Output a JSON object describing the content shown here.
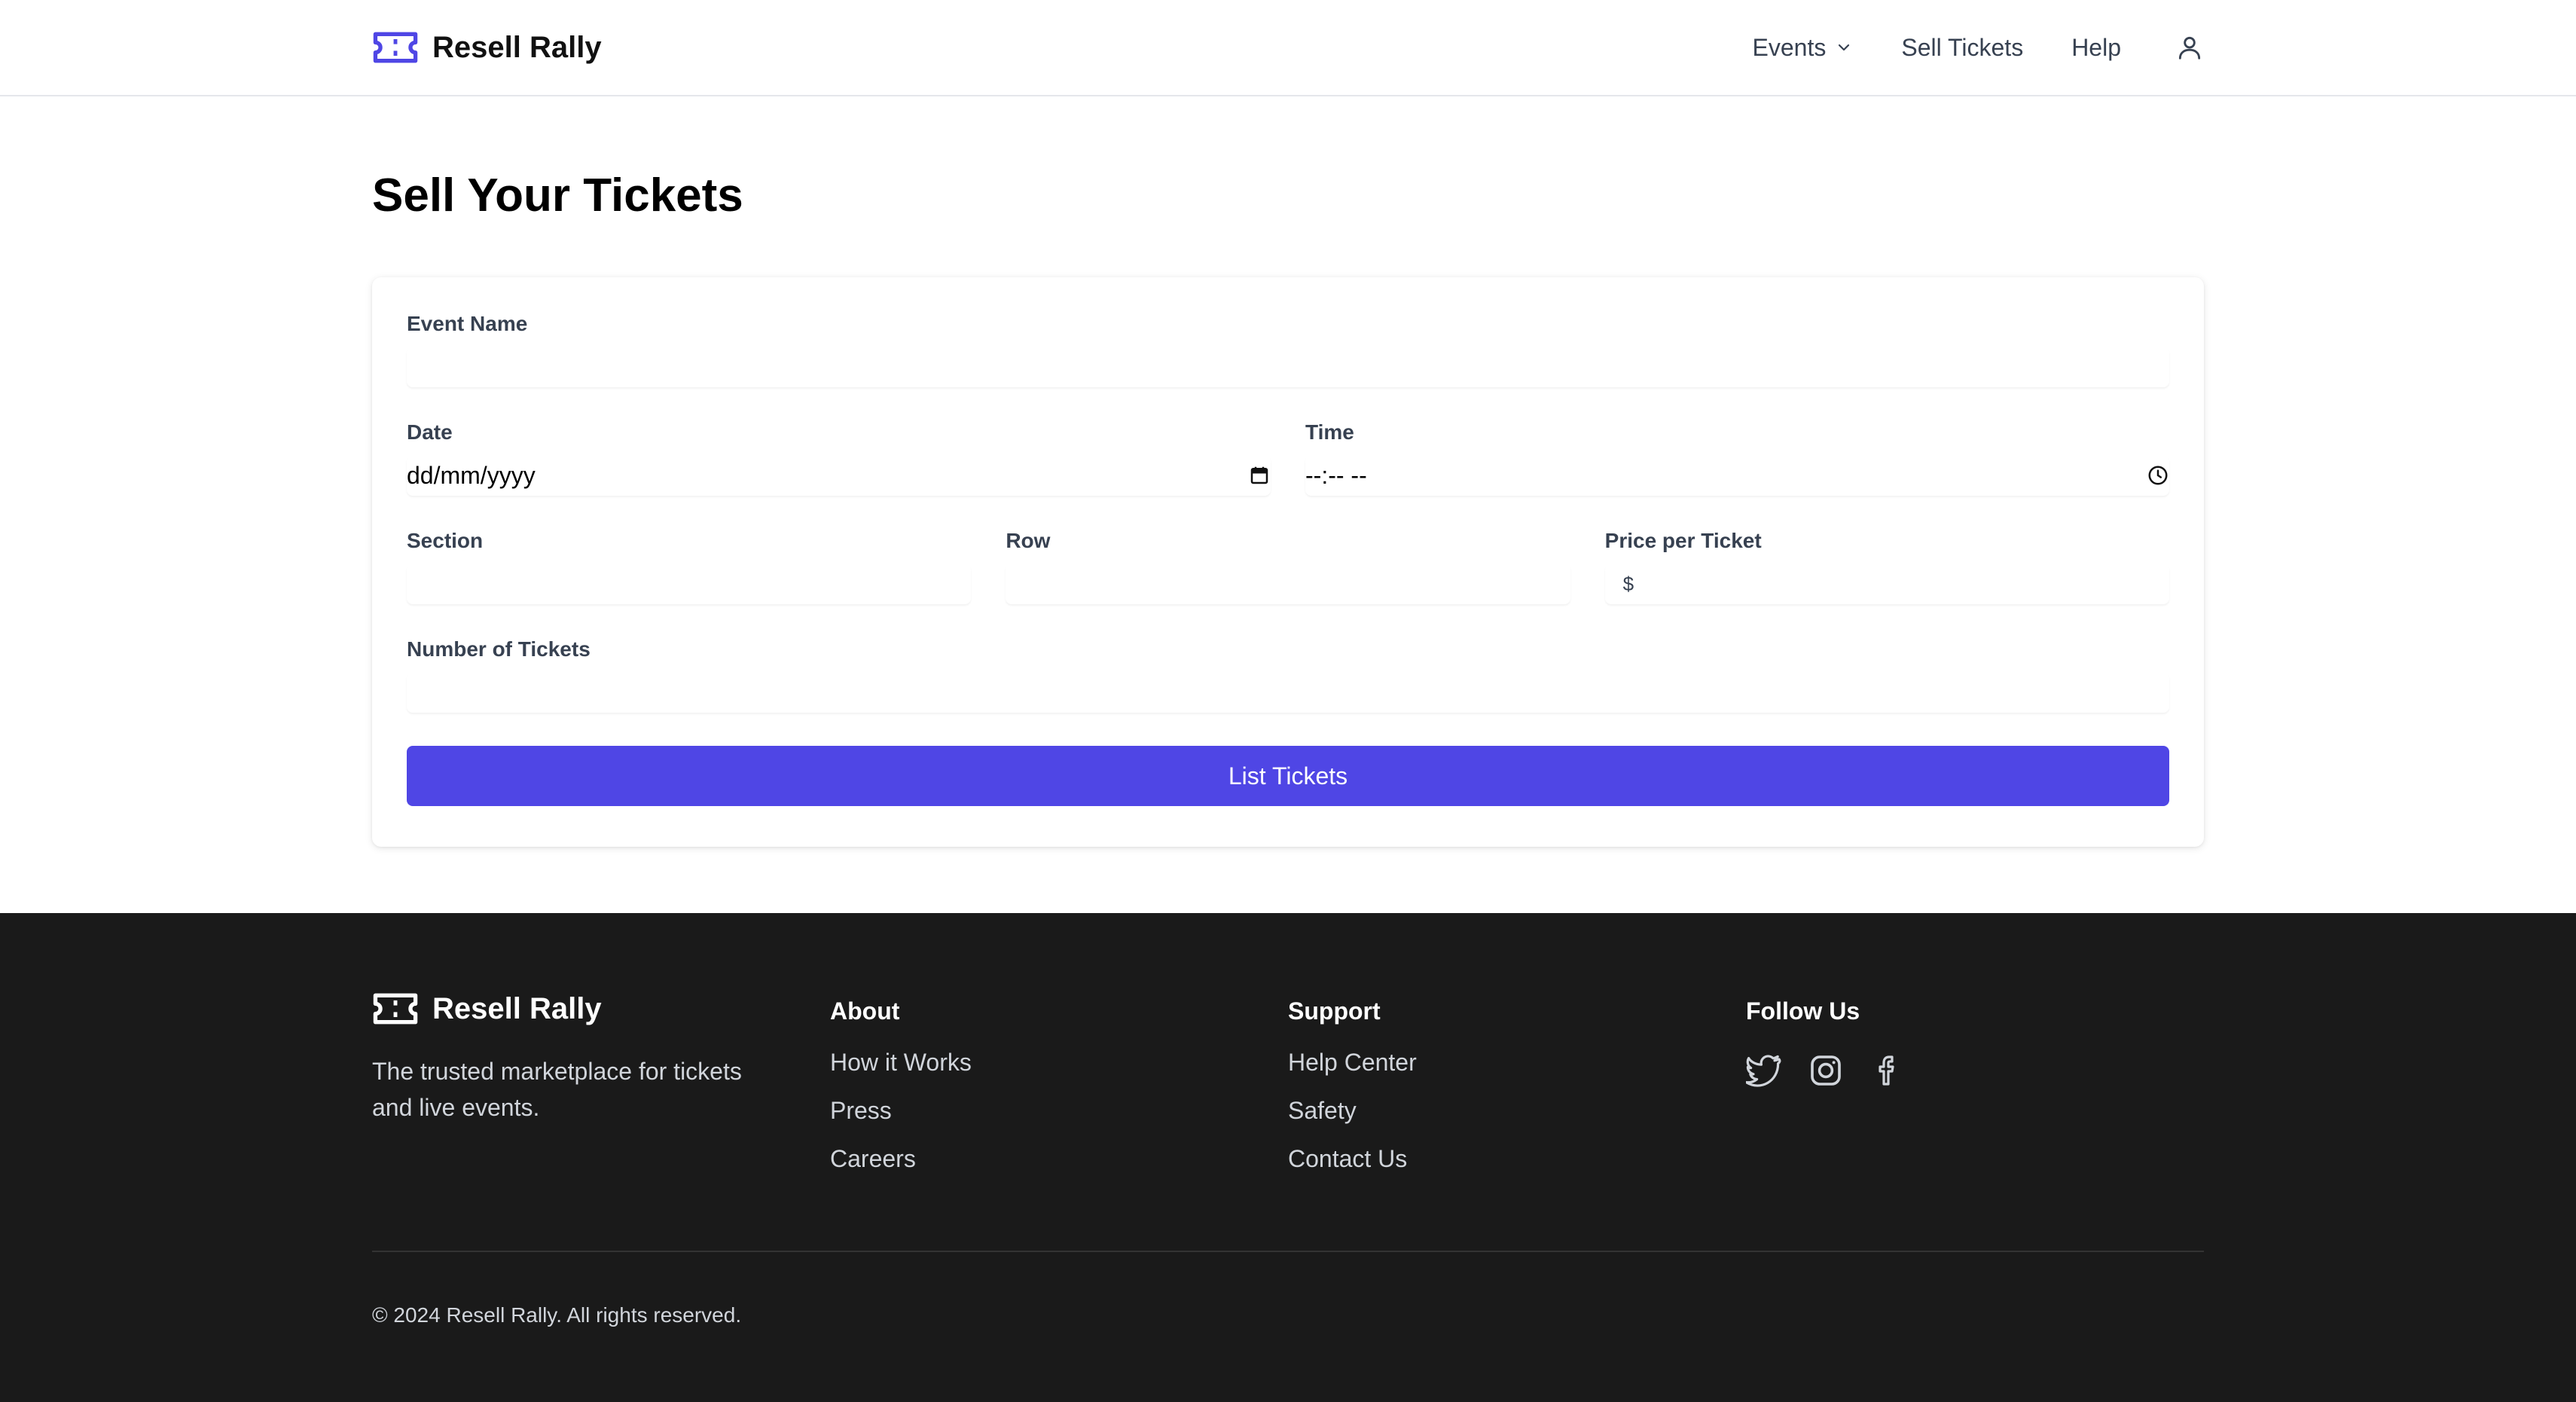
{
  "brand": {
    "name": "Resell Rally",
    "accent": "#4f46e5"
  },
  "nav": {
    "events_label": "Events",
    "sell_label": "Sell Tickets",
    "help_label": "Help",
    "account_icon": "user-icon",
    "events_icon": "chevron-down-icon"
  },
  "page": {
    "title": "Sell Your Tickets"
  },
  "form": {
    "event_name": {
      "label": "Event Name",
      "value": ""
    },
    "date": {
      "label": "Date",
      "value": "dd/mm/yyyy",
      "icon": "calendar-icon"
    },
    "time": {
      "label": "Time",
      "value": "--:-- --",
      "icon": "clock-icon"
    },
    "section": {
      "label": "Section",
      "value": ""
    },
    "row": {
      "label": "Row",
      "value": ""
    },
    "price": {
      "label": "Price per Ticket",
      "prefix": "$",
      "value": ""
    },
    "quantity": {
      "label": "Number of Tickets",
      "value": ""
    },
    "submit_label": "List Tickets"
  },
  "footer": {
    "brand_name": "Resell Rally",
    "tagline": "The trusted marketplace for tickets and live events.",
    "about": {
      "heading": "About",
      "links": [
        "How it Works",
        "Press",
        "Careers"
      ]
    },
    "support": {
      "heading": "Support",
      "links": [
        "Help Center",
        "Safety",
        "Contact Us"
      ]
    },
    "follow": {
      "heading": "Follow Us",
      "icons": [
        "twitter-icon",
        "instagram-icon",
        "facebook-icon"
      ]
    },
    "copyright": "© 2024 Resell Rally. All rights reserved.",
    "background": "#1a1a1a"
  }
}
